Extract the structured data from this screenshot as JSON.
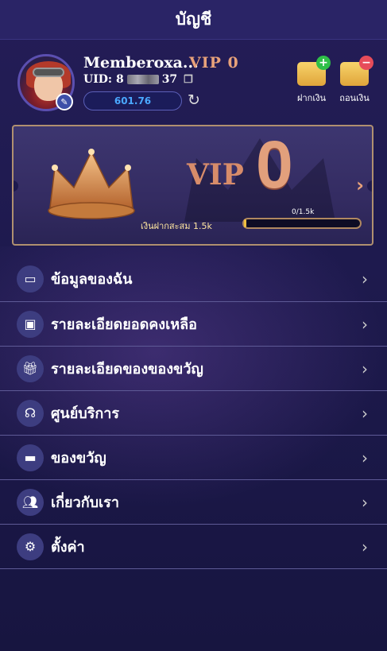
{
  "header": {
    "title": "บัญชี"
  },
  "profile": {
    "username": "Memberoxa...",
    "vip_badge": "VIP 0",
    "uid_prefix": "UID: 8",
    "uid_suffix": "37",
    "balance": "601.76"
  },
  "actions": {
    "deposit_label": "ฝากเงิน",
    "withdraw_label": "ถอนเงิน"
  },
  "vip_card": {
    "vip_label": "VIP",
    "level": "0",
    "deposit_total_label": "เงินฝากสะสม 1.5k",
    "progress_text": "0/1.5k",
    "progress_fraction": 0.02
  },
  "menu": {
    "items": [
      {
        "label": "ข้อมูลของฉัน",
        "icon": "card-icon"
      },
      {
        "label": "รายละเอียดยอดคงเหลือ",
        "icon": "wallet-icon"
      },
      {
        "label": "รายละเอียดของของขวัญ",
        "icon": "gift-icon"
      },
      {
        "label": "ศูนย์บริการ",
        "icon": "headset-icon"
      },
      {
        "label": "ของขวัญ",
        "icon": "ticket-icon"
      },
      {
        "label": "เกี่ยวกับเรา",
        "icon": "users-icon"
      },
      {
        "label": "ตั้งค่า",
        "icon": "gear-icon"
      }
    ]
  }
}
